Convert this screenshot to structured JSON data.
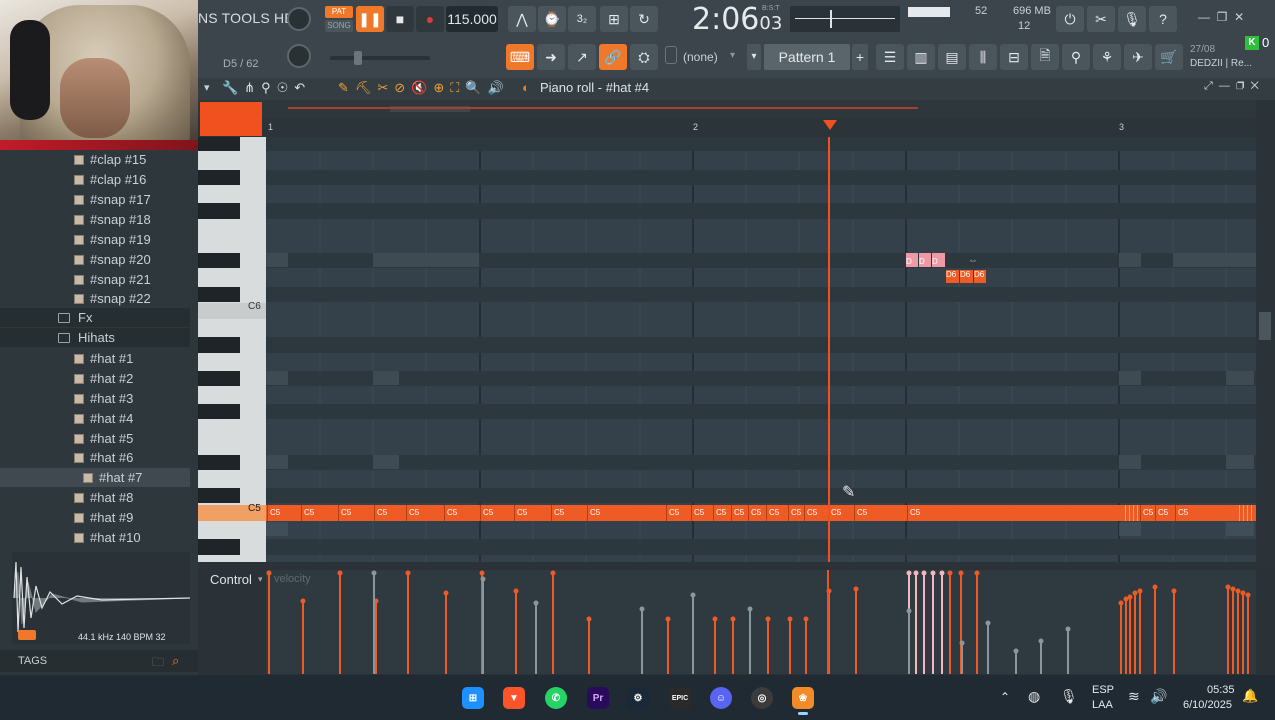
{
  "menu": {
    "label": "NS TOOLS HELP"
  },
  "transport": {
    "pat_label": "PAT",
    "song_label": "SONG",
    "tempo": "115.000",
    "time": "2:06",
    "time_small": "03",
    "bst": "B:S:T",
    "cpu_value": "52",
    "memory": "696 MB",
    "polyphony": "12"
  },
  "hint": {
    "text": "D5 / 62"
  },
  "pattern": {
    "label": "Pattern 1",
    "channel_select": "(none)"
  },
  "project": {
    "date": "27/08",
    "name": "DEDZII | Re..."
  },
  "kbadge": {
    "letter": "K",
    "count": "0"
  },
  "piano_roll": {
    "title": "Piano roll - #hat #4"
  },
  "timeline": {
    "markers": [
      "1",
      "2",
      "3"
    ]
  },
  "keys": {
    "c6": "C6",
    "c5": "C5"
  },
  "notes": {
    "c5_label": "C5",
    "d6_label": "D6",
    "d_short": "D",
    "c5_positions": [
      1,
      35,
      72,
      108,
      140,
      178,
      214,
      248,
      285,
      321,
      400,
      425,
      447,
      465,
      482,
      500,
      522,
      538,
      562,
      588,
      641,
      874,
      889,
      909
    ]
  },
  "control": {
    "label": "Control",
    "param": "velocity"
  },
  "browser": {
    "items": [
      {
        "label": "#clap #15",
        "type": "file"
      },
      {
        "label": "#clap #16",
        "type": "file"
      },
      {
        "label": "#snap #17",
        "type": "file"
      },
      {
        "label": "#snap #18",
        "type": "file"
      },
      {
        "label": "#snap #19",
        "type": "file"
      },
      {
        "label": "#snap #20",
        "type": "file"
      },
      {
        "label": "#snap #21",
        "type": "file"
      },
      {
        "label": "#snap #22",
        "type": "file"
      },
      {
        "label": "Fx",
        "type": "folder"
      },
      {
        "label": "Hihats",
        "type": "folder"
      },
      {
        "label": "#hat #1",
        "type": "file"
      },
      {
        "label": "#hat #2",
        "type": "file"
      },
      {
        "label": "#hat #3",
        "type": "file"
      },
      {
        "label": "#hat #4",
        "type": "file"
      },
      {
        "label": "#hat #5",
        "type": "file"
      },
      {
        "label": "#hat #6",
        "type": "file"
      },
      {
        "label": "#hat #7",
        "type": "file"
      },
      {
        "label": "#hat #8",
        "type": "file"
      },
      {
        "label": "#hat #9",
        "type": "file"
      },
      {
        "label": "#hat #10",
        "type": "file"
      }
    ],
    "sample_info": "44.1 kHz 140 BPM 32",
    "tags_label": "TAGS"
  },
  "taskbar": {
    "lang_top": "ESP",
    "lang_bottom": "LAA",
    "time": "05:35",
    "date": "6/10/2025",
    "apps": [
      "windows-icon",
      "brave-icon",
      "whatsapp-icon",
      "premiere-icon",
      "steam-icon",
      "epic-icon",
      "discord-icon",
      "chrome-icon",
      "flstudio-icon"
    ],
    "premiere_text": "Pr",
    "epic_text": "EPIC"
  },
  "colors": {
    "accent": "#f0782a",
    "note": "#ef5b25",
    "grid": "#34414a",
    "toolbar": "#3b454b"
  }
}
